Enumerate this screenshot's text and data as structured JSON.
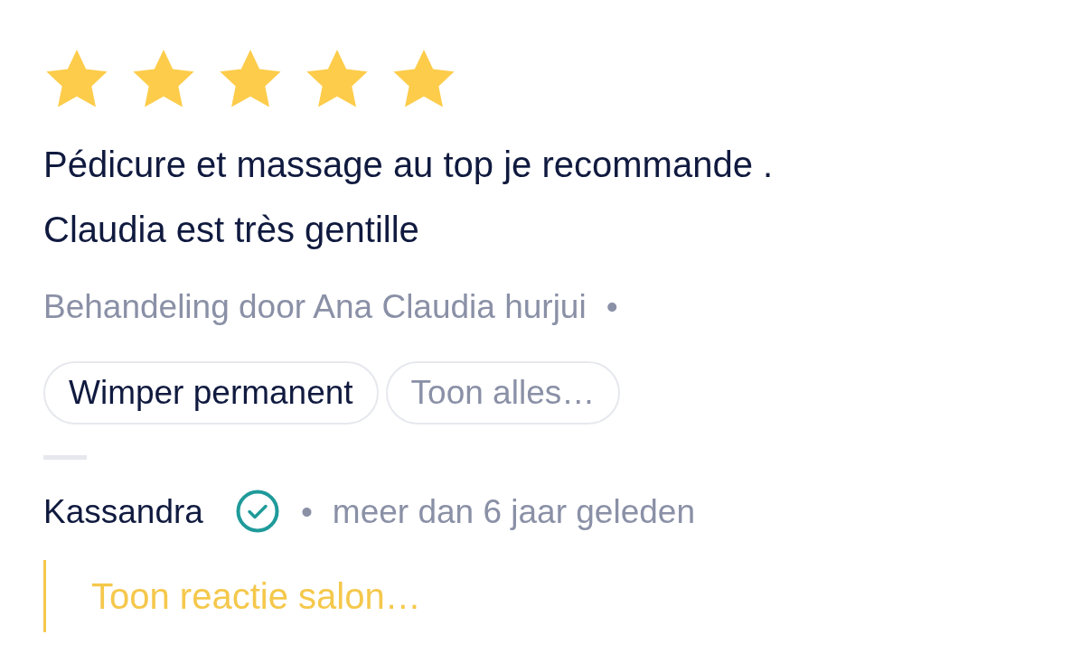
{
  "review": {
    "stars": 5,
    "text": "Pédicure et massage au top je recommande .\nClaudia est très gentille",
    "treatment_by": "Behandeling door Ana Claudia hurjui",
    "treatment_separator": "•",
    "chips": [
      {
        "label": "Wimper permanent",
        "kind": "service"
      },
      {
        "label": "Toon alles…",
        "kind": "more"
      }
    ],
    "author": "Kassandra",
    "verified": true,
    "meta_separator": "•",
    "time": "meer dan 6 jaar geleden",
    "salon_reply_link": "Toon reactie salon…"
  }
}
